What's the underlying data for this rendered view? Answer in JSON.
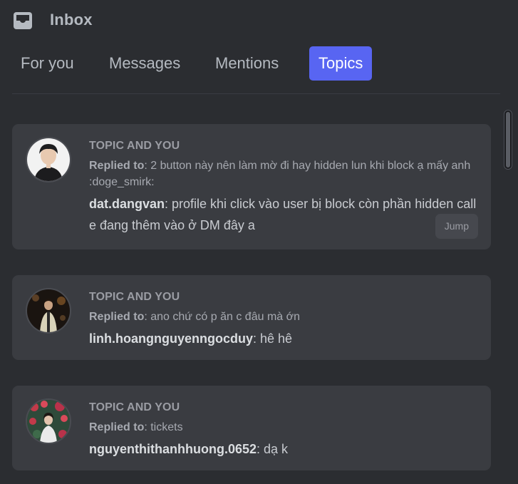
{
  "header": {
    "title": "Inbox",
    "icon": "inbox-icon"
  },
  "tabs": [
    {
      "label": "For you",
      "active": false
    },
    {
      "label": "Messages",
      "active": false
    },
    {
      "label": "Mentions",
      "active": false
    },
    {
      "label": "Topics",
      "active": true
    }
  ],
  "colors": {
    "accent": "#5865f2",
    "background": "#2b2d31",
    "card": "#3a3c41"
  },
  "cards": [
    {
      "label": "TOPIC AND YOU",
      "replied_prefix": "Replied to",
      "replied_text": ": 2 button này nên làm mờ đi hay hidden lun khi block ạ mấy anh :doge_smirk:",
      "author": "dat.dangvan",
      "message": ": profile khi click vào user bị block còn phần hidden call e đang thêm vào ở DM đây a",
      "jump_label": "Jump",
      "avatar_icon": "user-avatar"
    },
    {
      "label": "TOPIC AND YOU",
      "replied_prefix": "Replied to",
      "replied_text": ": ano chứ có p ăn c đâu mà ớn",
      "author": "linh.hoangnguyenngocduy",
      "message": ": hê hê",
      "avatar_icon": "user-avatar"
    },
    {
      "label": "TOPIC AND YOU",
      "replied_prefix": "Replied to",
      "replied_text": ": tickets",
      "author": "nguyenthithanhhuong.0652",
      "message": ": dạ k",
      "avatar_icon": "user-avatar"
    }
  ]
}
